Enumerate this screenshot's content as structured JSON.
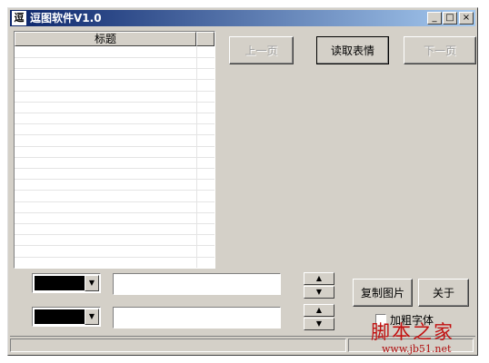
{
  "window": {
    "icon_glyph": "逗",
    "title": "逗图软件V1.0"
  },
  "titlebar_buttons": {
    "minimize": "_",
    "maximize": "□",
    "close": "×"
  },
  "list": {
    "columns": [
      "标题",
      ""
    ]
  },
  "nav": {
    "prev": "上一页",
    "read": "读取表情",
    "next": "下一页"
  },
  "text_rows": [
    {
      "color": "#000000",
      "value": ""
    },
    {
      "color": "#000000",
      "value": ""
    }
  ],
  "spinners": {
    "up": "▲",
    "down": "▼"
  },
  "actions": {
    "copy": "复制图片",
    "about": "关于"
  },
  "bold_font": {
    "label": "加粗字体",
    "checked": false
  },
  "watermark": {
    "brand": "脚本之家",
    "url": "www.jb51.net"
  }
}
